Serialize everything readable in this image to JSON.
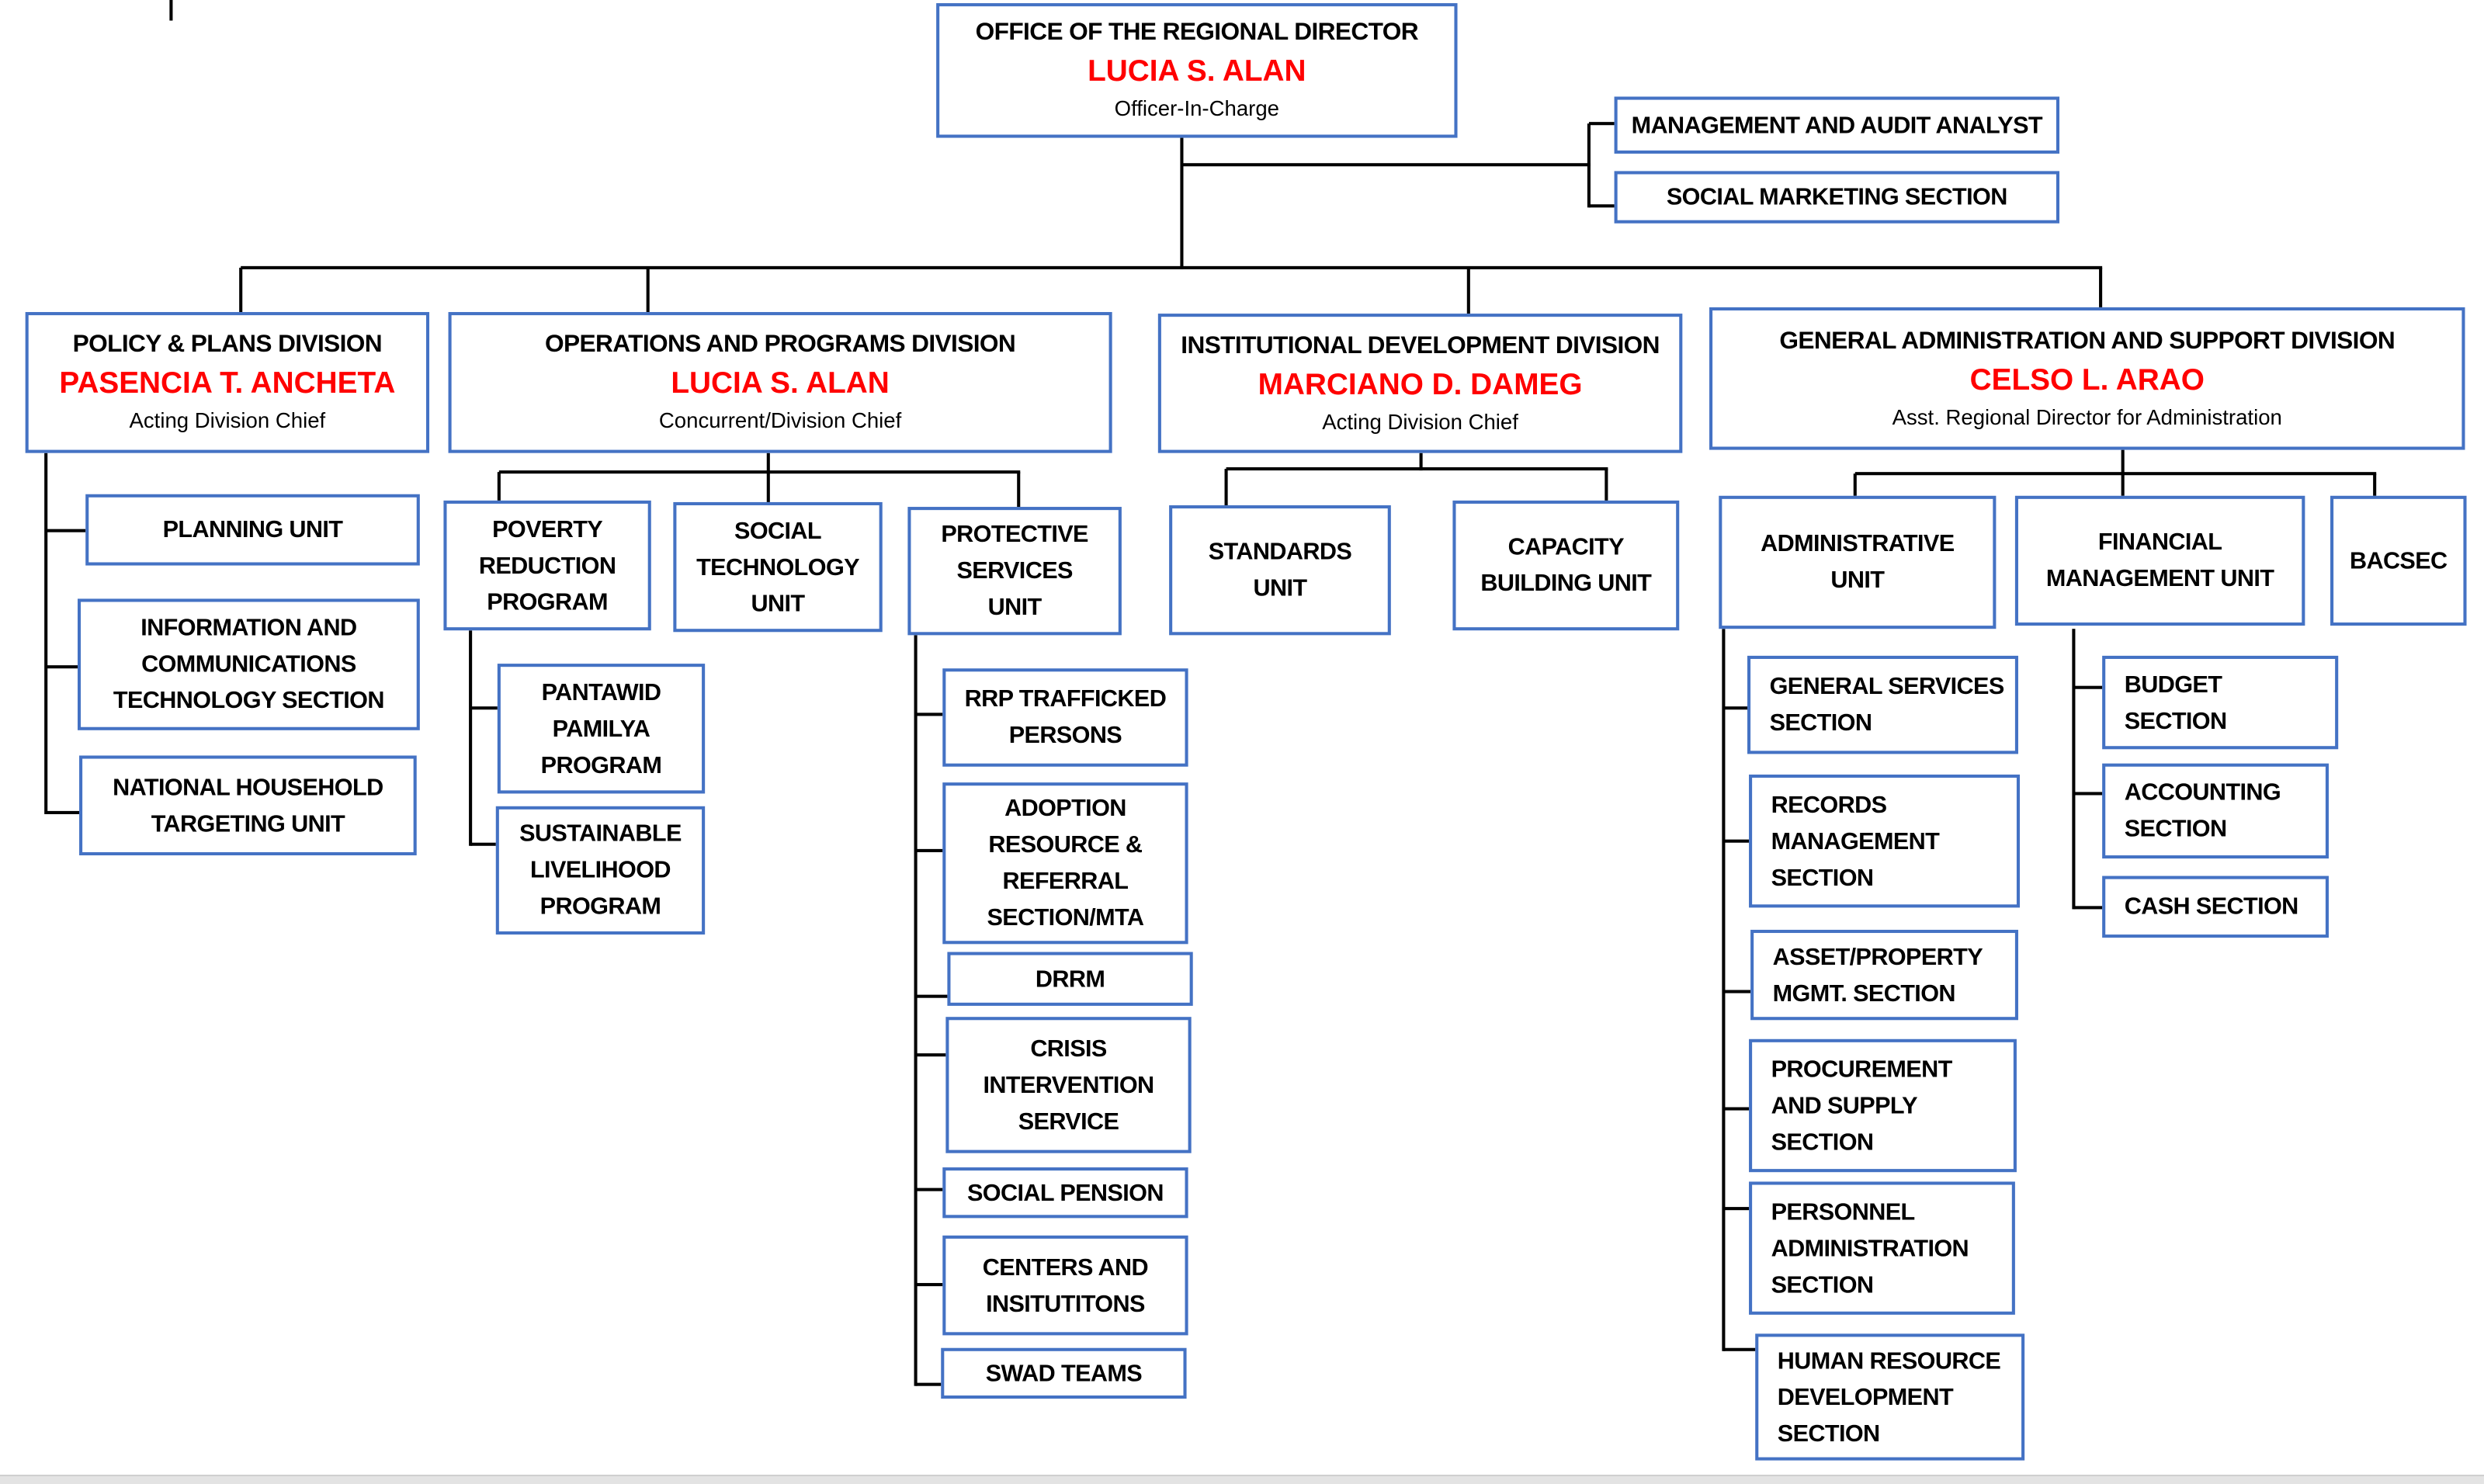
{
  "colors": {
    "box_border": "#4472c4",
    "name_text": "#ff0000",
    "connector": "#000000"
  },
  "boxes": {
    "ord": {
      "title": "OFFICE OF THE REGIONAL DIRECTOR",
      "name": "LUCIA S. ALAN",
      "role": "Officer-In-Charge"
    },
    "maa": {
      "lines": [
        "MANAGEMENT AND AUDIT ANALYST"
      ]
    },
    "sms": {
      "lines": [
        "SOCIAL MARKETING SECTION"
      ]
    },
    "policy": {
      "title": "POLICY & PLANS DIVISION",
      "name": "PASENCIA T. ANCHETA",
      "role": "Acting Division Chief"
    },
    "ops": {
      "title": "OPERATIONS AND PROGRAMS DIVISION",
      "name": "LUCIA S. ALAN",
      "role": "Concurrent/Division Chief"
    },
    "inst": {
      "title": "INSTITUTIONAL DEVELOPMENT DIVISION",
      "name": "MARCIANO D. DAMEG",
      "role": "Acting Division Chief"
    },
    "gen": {
      "title": "GENERAL ADMINISTRATION AND SUPPORT DIVISION",
      "name": "CELSO L. ARAO",
      "role": "Asst. Regional Director for Administration"
    },
    "planning": {
      "lines": [
        "PLANNING UNIT"
      ]
    },
    "ict": {
      "lines": [
        "INFORMATION AND",
        "COMMUNICATIONS",
        "TECHNOLOGY SECTION"
      ]
    },
    "nhtu": {
      "lines": [
        "NATIONAL HOUSEHOLD",
        "TARGETING UNIT"
      ]
    },
    "poverty": {
      "lines": [
        "POVERTY",
        "REDUCTION",
        "PROGRAM"
      ]
    },
    "soctech": {
      "lines": [
        "SOCIAL",
        "TECHNOLOGY",
        "UNIT"
      ]
    },
    "protective": {
      "lines": [
        "PROTECTIVE",
        "SERVICES",
        "UNIT"
      ]
    },
    "pantawid": {
      "lines": [
        "PANTAWID",
        "PAMILYA",
        "PROGRAM"
      ]
    },
    "sustainable": {
      "lines": [
        "SUSTAINABLE",
        "LIVELIHOOD",
        "PROGRAM"
      ]
    },
    "rrp": {
      "lines": [
        "RRP TRAFFICKED",
        "PERSONS"
      ]
    },
    "adoption": {
      "lines": [
        "ADOPTION",
        "RESOURCE &",
        "REFERRAL",
        "SECTION/MTA"
      ]
    },
    "drrm": {
      "lines": [
        "DRRM"
      ]
    },
    "crisis": {
      "lines": [
        "CRISIS",
        "INTERVENTION",
        "SERVICE"
      ]
    },
    "pension": {
      "lines": [
        "SOCIAL PENSION"
      ]
    },
    "centers": {
      "lines": [
        "CENTERS AND",
        "INSITUTITONS"
      ]
    },
    "swad": {
      "lines": [
        "SWAD TEAMS"
      ]
    },
    "standards": {
      "lines": [
        "STANDARDS",
        "UNIT"
      ]
    },
    "capacity": {
      "lines": [
        "CAPACITY",
        "BUILDING UNIT"
      ]
    },
    "admin": {
      "lines": [
        "ADMINISTRATIVE",
        "UNIT"
      ]
    },
    "financial": {
      "lines": [
        "FINANCIAL",
        "MANAGEMENT UNIT"
      ]
    },
    "bacsec": {
      "lines": [
        "BACSEC"
      ]
    },
    "gss": {
      "lines": [
        "GENERAL SERVICES",
        "SECTION"
      ]
    },
    "records": {
      "lines": [
        "RECORDS",
        "MANAGEMENT",
        "SECTION"
      ]
    },
    "asset": {
      "lines": [
        "ASSET/PROPERTY",
        "MGMT. SECTION"
      ]
    },
    "procurement": {
      "lines": [
        "PROCUREMENT",
        "AND SUPPLY",
        "SECTION"
      ]
    },
    "personnel": {
      "lines": [
        "PERSONNEL",
        "ADMINISTRATION",
        "SECTION"
      ]
    },
    "hrd": {
      "lines": [
        "HUMAN RESOURCE",
        "DEVELOPMENT",
        "SECTION"
      ]
    },
    "budget": {
      "lines": [
        "BUDGET",
        "SECTION"
      ]
    },
    "accounting": {
      "lines": [
        "ACCOUNTING",
        "SECTION"
      ]
    },
    "cash": {
      "lines": [
        "CASH SECTION"
      ]
    }
  }
}
